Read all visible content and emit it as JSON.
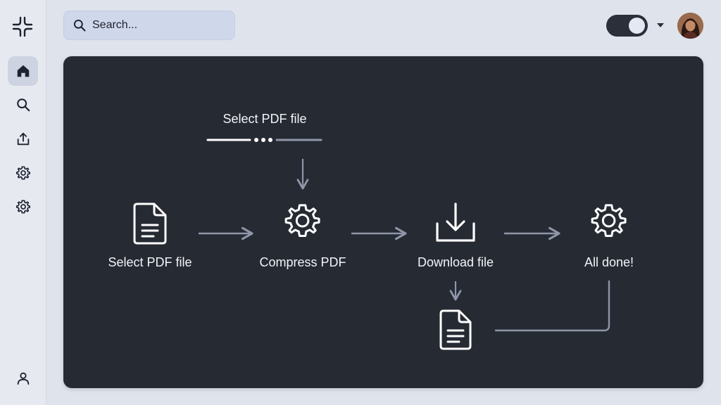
{
  "search": {
    "placeholder": "Search..."
  },
  "sidebar": {
    "items": [
      {
        "name": "home",
        "icon": "home-icon",
        "active": true
      },
      {
        "name": "search",
        "icon": "search-icon",
        "active": false
      },
      {
        "name": "upload",
        "icon": "upload-icon",
        "active": false
      },
      {
        "name": "settings",
        "icon": "gear-icon",
        "active": false
      },
      {
        "name": "settings-2",
        "icon": "gear-icon",
        "active": false
      }
    ],
    "bottom_icon": "user-icon"
  },
  "header": {
    "theme_toggle": {
      "state": "on"
    },
    "menu_icon": "caret-down-icon",
    "avatar_icon": "avatar"
  },
  "flow": {
    "top_label": "Select PDF file",
    "steps": [
      {
        "label": "Select PDF file",
        "icon": "document-icon"
      },
      {
        "label": "Compress PDF",
        "icon": "gear-icon"
      },
      {
        "label": "Download file",
        "icon": "download-icon"
      },
      {
        "label": "All done!",
        "icon": "gear-icon"
      }
    ],
    "output_icon": "document-icon"
  },
  "colors": {
    "panel_bg": "#262a33",
    "page_bg": "#dfe3ec",
    "search_bg": "#cfd7ea",
    "line": "#8e96a8",
    "icon_light": "#ffffff"
  }
}
